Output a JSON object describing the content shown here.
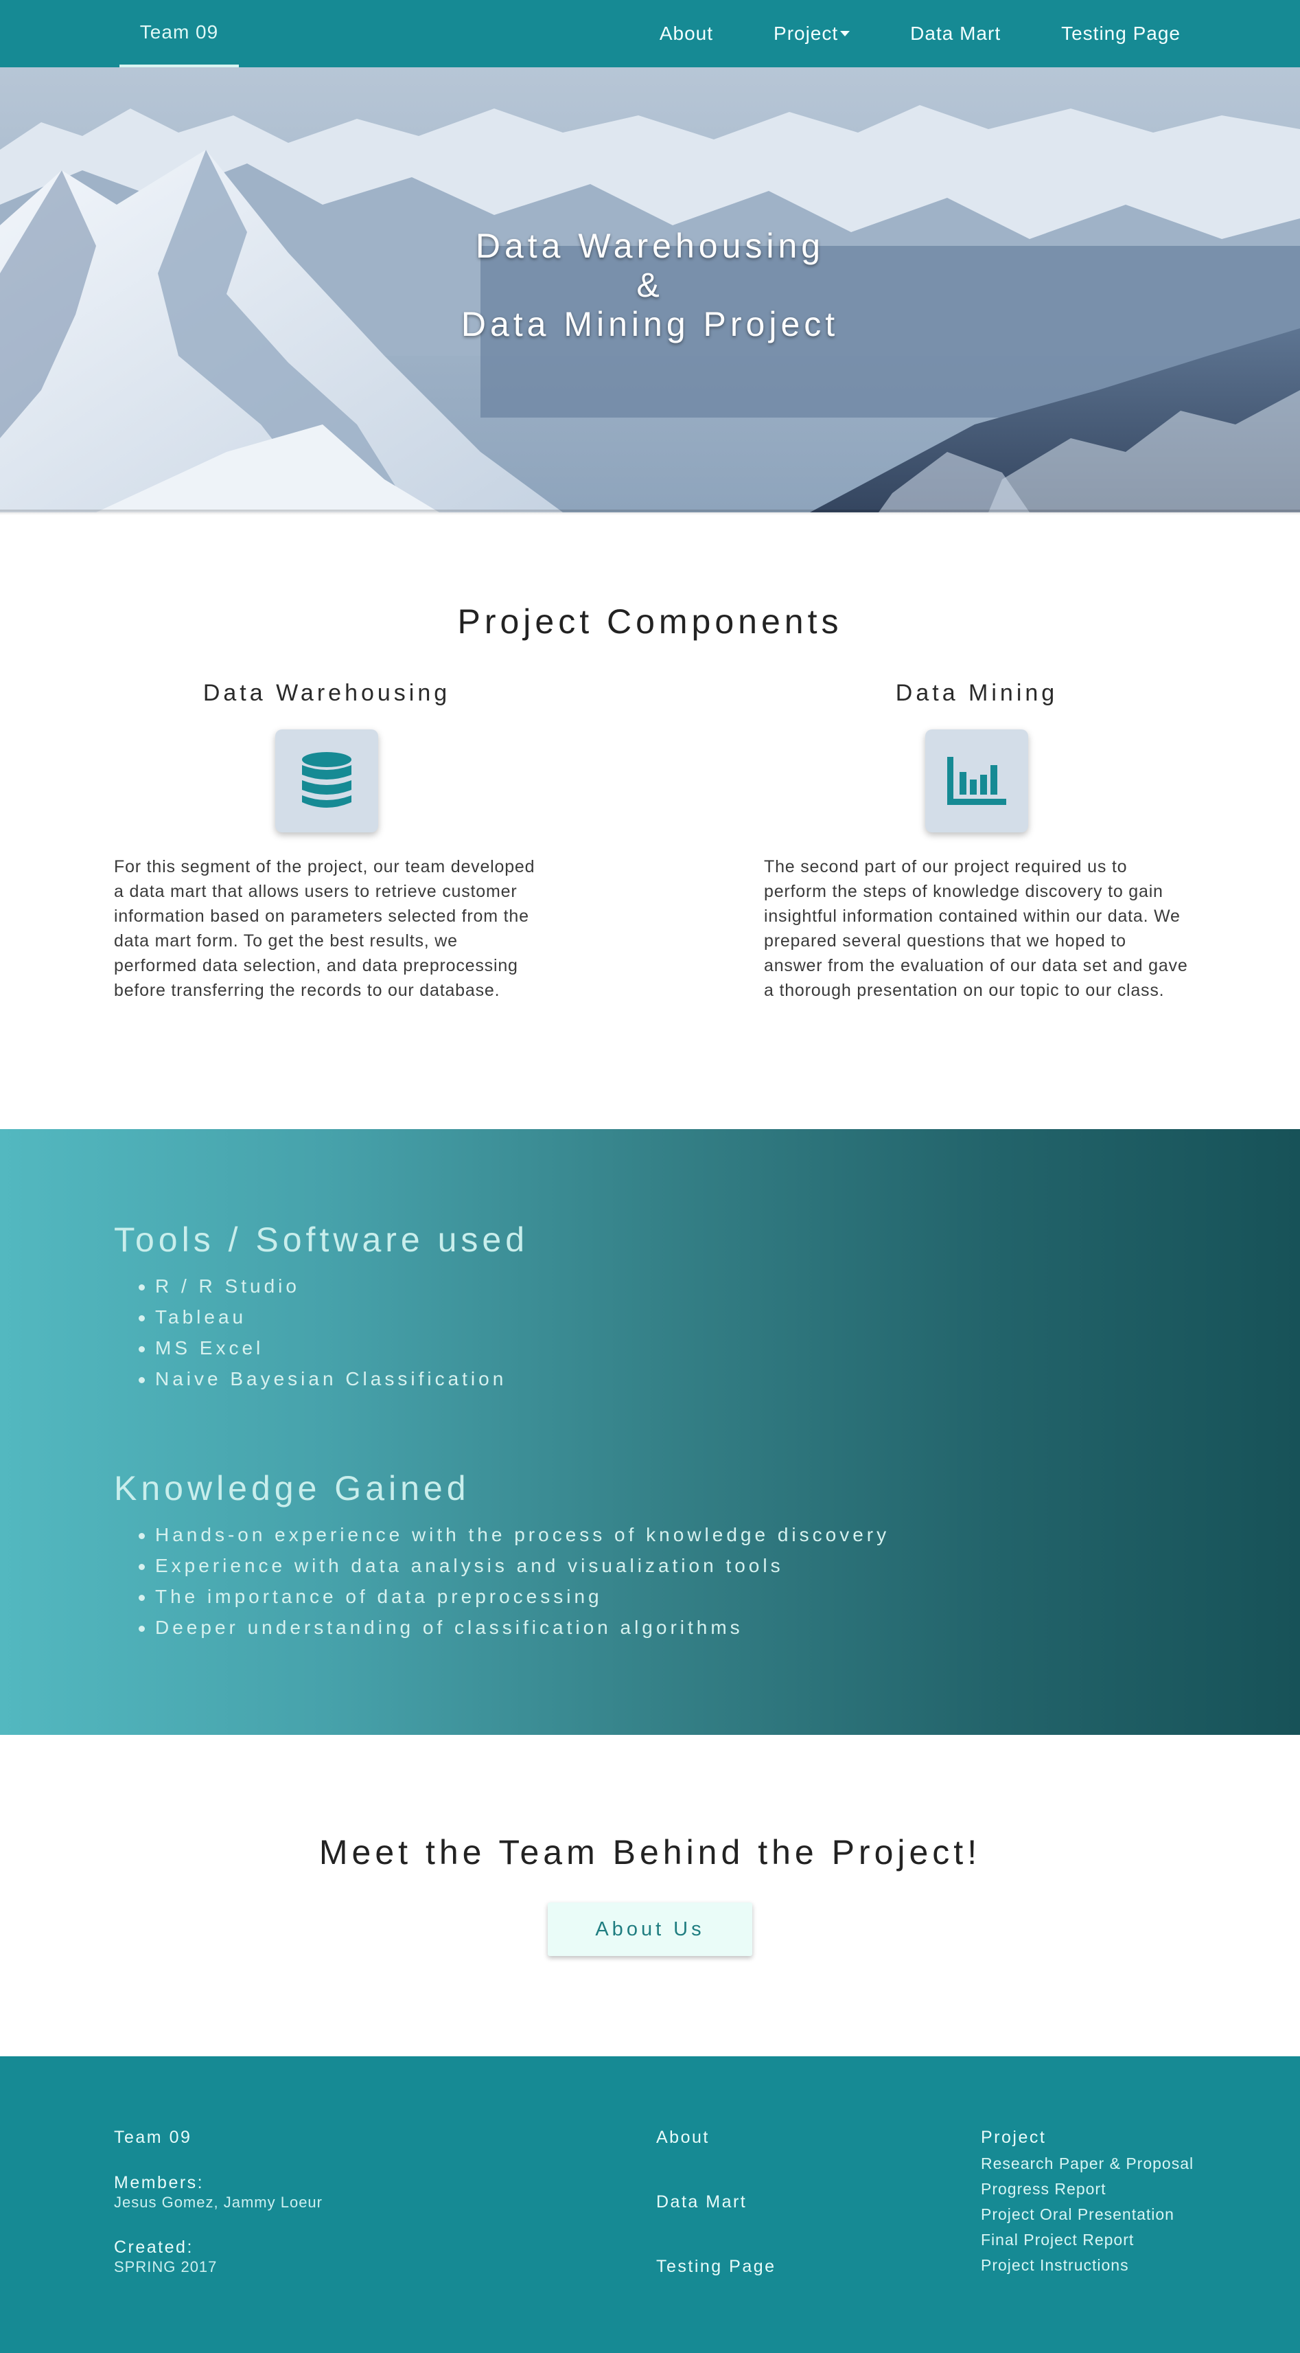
{
  "nav": {
    "brand": "Team 09",
    "links": [
      "About",
      "Project",
      "Data Mart",
      "Testing Page"
    ]
  },
  "hero": {
    "line1": "Data Warehousing",
    "line2": "&",
    "line3": "Data Mining Project"
  },
  "components": {
    "title": "Project Components",
    "warehousing": {
      "heading": "Data Warehousing",
      "icon": "database-icon",
      "text": "For this segment of the project, our team developed a data mart that allows users to retrieve customer information based on parameters selected from the data mart form. To get the best results, we performed data selection, and data preprocessing before transferring the records to our database."
    },
    "mining": {
      "heading": "Data Mining",
      "icon": "bar-chart-icon",
      "text": "The second part of our project required us to perform the steps of knowledge discovery to gain insightful information contained within our data. We prepared several questions that we hoped to answer from the evaluation of our data set and gave a thorough presentation on our topic to our class."
    }
  },
  "tools": {
    "title": "Tools / Software used",
    "items": [
      "R / R Studio",
      "Tableau",
      "MS Excel",
      "Naive Bayesian Classification"
    ]
  },
  "knowledge": {
    "title": "Knowledge Gained",
    "items": [
      "Hands-on experience with the process of knowledge discovery",
      "Experience with data analysis and visualization tools",
      "The importance of data preprocessing",
      "Deeper understanding of classification algorithms"
    ]
  },
  "team": {
    "title": "Meet the Team Behind the Project!",
    "button": "About Us"
  },
  "footer": {
    "team_name": "Team 09",
    "members_label": "Members:",
    "members": "Jesus Gomez, Jammy Loeur",
    "created_label": "Created:",
    "created": "SPRING 2017",
    "links": [
      "About",
      "Data Mart",
      "Testing Page"
    ],
    "project_label": "Project",
    "project_links": [
      "Research Paper & Proposal",
      "Progress Report",
      "Project Oral Presentation",
      "Final Project Report",
      "Project Instructions"
    ]
  },
  "colors": {
    "primary": "#168a94",
    "icon_box": "#d3dde8",
    "button_bg": "#eafcf8"
  }
}
